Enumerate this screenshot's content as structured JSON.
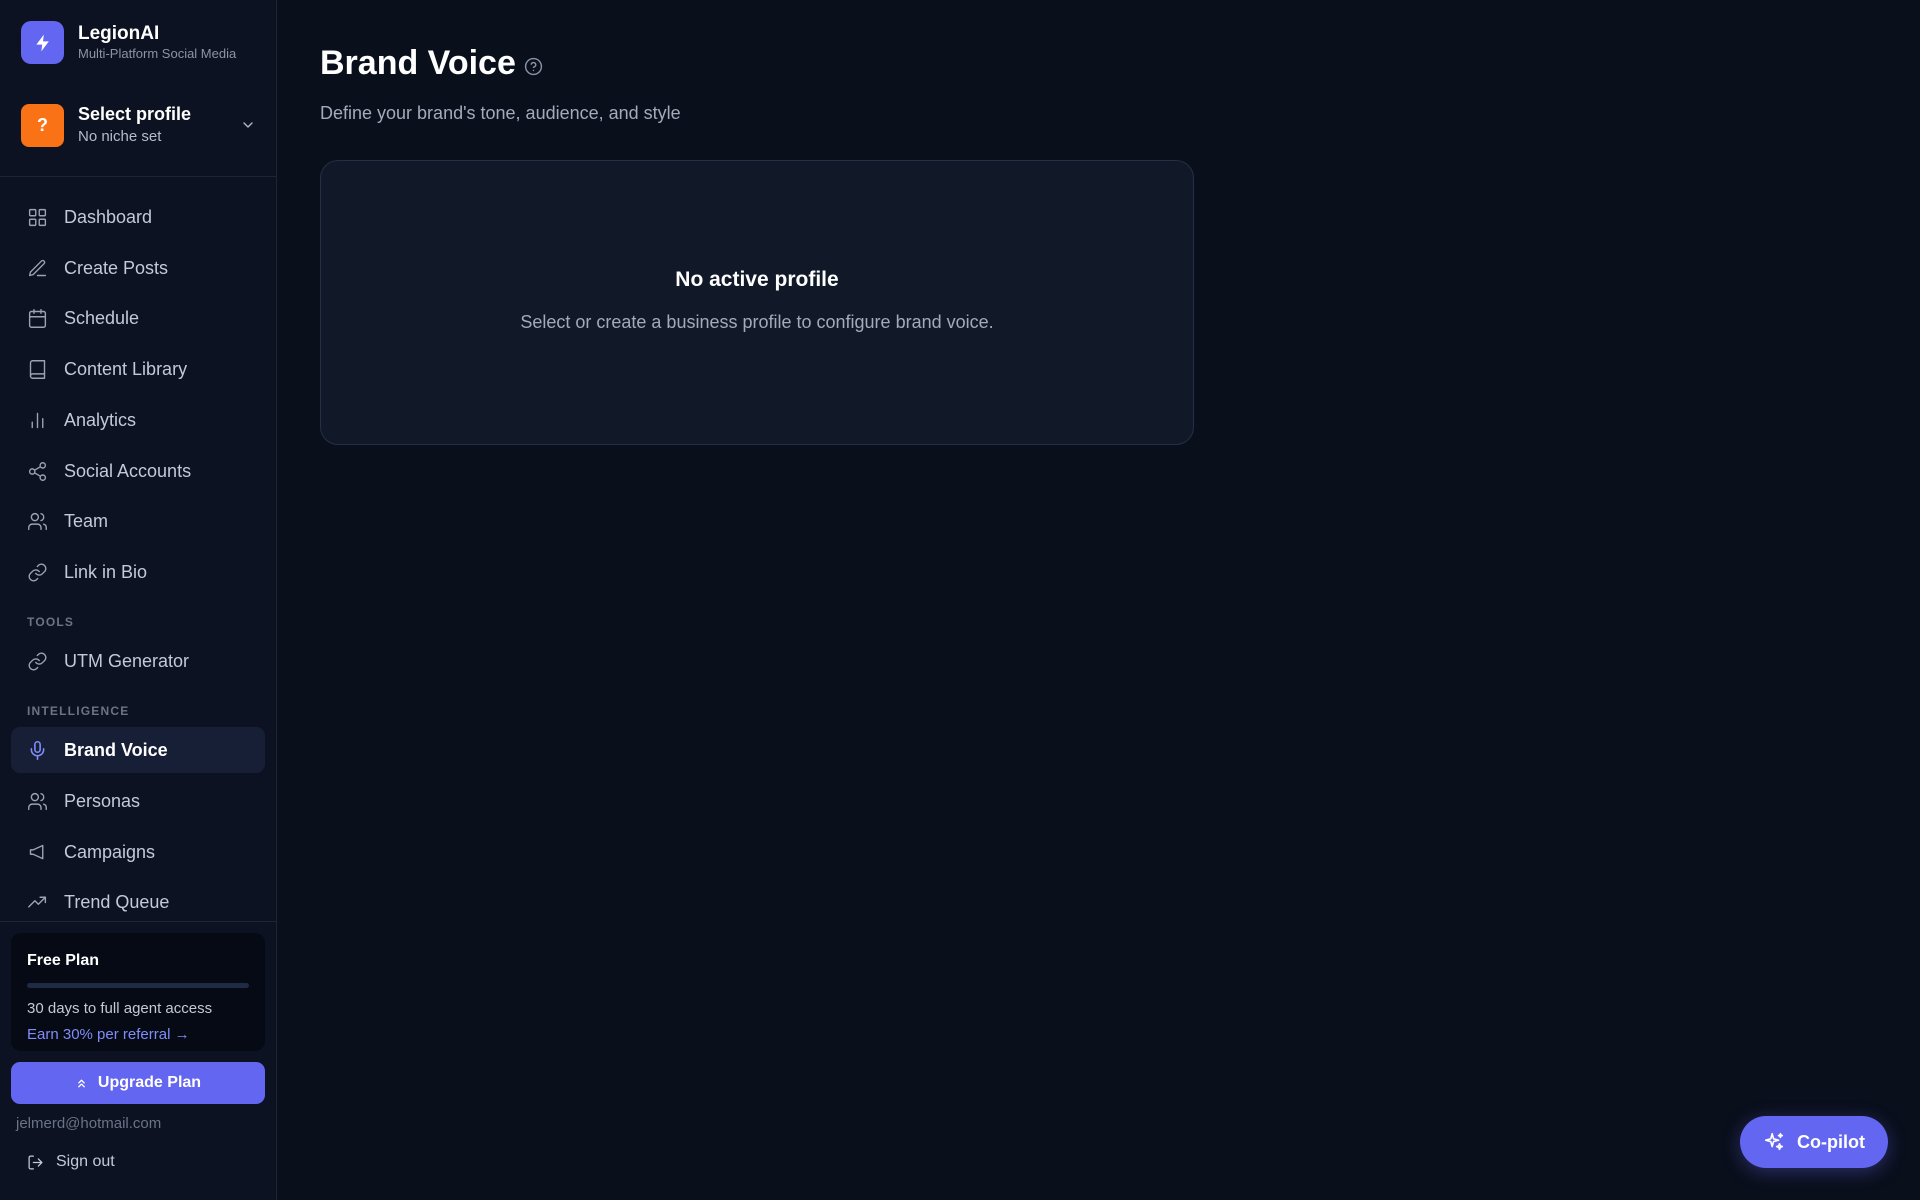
{
  "colors": {
    "accent": "#6366f1",
    "profile_badge": "#f97316",
    "background": "#0a0f1c",
    "sidebar_bg": "#0c1221"
  },
  "brand": {
    "name": "LegionAI",
    "tagline": "Multi-Platform Social Media",
    "icon": "lightning-bolt-icon"
  },
  "profile": {
    "badge": "?",
    "name": "Select profile",
    "niche": "No niche set"
  },
  "nav": {
    "main": [
      {
        "label": "Dashboard",
        "icon": "grid-icon"
      },
      {
        "label": "Create Posts",
        "icon": "pen-icon"
      },
      {
        "label": "Schedule",
        "icon": "calendar-icon"
      },
      {
        "label": "Content Library",
        "icon": "book-icon"
      },
      {
        "label": "Analytics",
        "icon": "bar-chart-icon"
      },
      {
        "label": "Social Accounts",
        "icon": "share-icon"
      },
      {
        "label": "Team",
        "icon": "users-icon"
      },
      {
        "label": "Link in Bio",
        "icon": "link-icon"
      }
    ],
    "tools_label": "TOOLS",
    "tools": [
      {
        "label": "UTM Generator",
        "icon": "link-icon"
      }
    ],
    "intelligence_label": "INTELLIGENCE",
    "intelligence": [
      {
        "label": "Brand Voice",
        "icon": "microphone-icon",
        "active": true
      },
      {
        "label": "Personas",
        "icon": "users-icon"
      },
      {
        "label": "Campaigns",
        "icon": "megaphone-icon"
      },
      {
        "label": "Trend Queue",
        "icon": "trending-up-icon"
      }
    ]
  },
  "plan": {
    "title": "Free Plan",
    "progress": 0,
    "description": "30 days to full agent access",
    "referral_link": "Earn 30% per referral →",
    "upgrade_label": "Upgrade Plan"
  },
  "user": {
    "email": "jelmerd@hotmail.com",
    "signout_label": "Sign out"
  },
  "page": {
    "title": "Brand Voice",
    "subtitle": "Define your brand's tone, audience, and style"
  },
  "empty_state": {
    "title": "No active profile",
    "description": "Select or create a business profile to configure brand voice."
  },
  "copilot": {
    "label": "Co-pilot"
  }
}
